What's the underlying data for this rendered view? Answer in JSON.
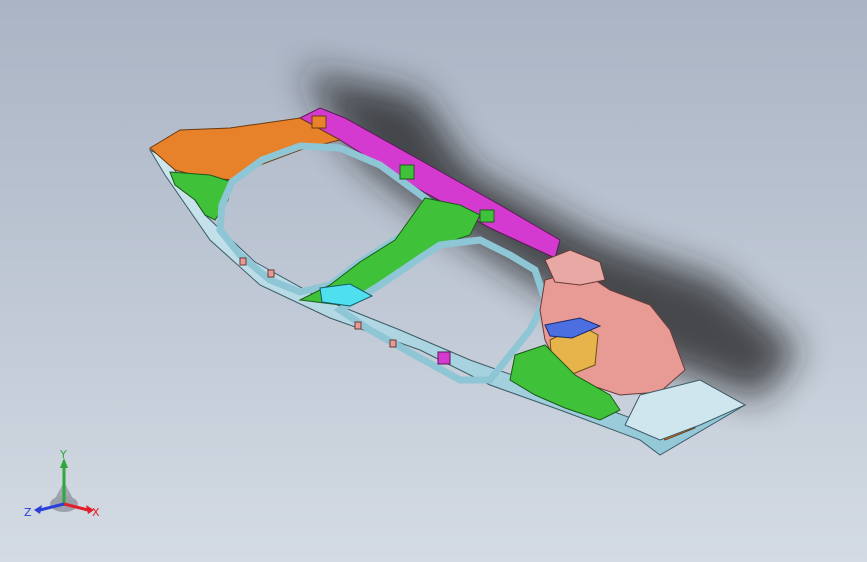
{
  "viewport": {
    "background_top": "#aab4c4",
    "background_bottom": "#d4dbe4"
  },
  "model": {
    "colors": {
      "orange": "#e8822a",
      "magenta": "#d43ad0",
      "green": "#3fc23a",
      "teal": "#9fd7e6",
      "pink": "#e89a95",
      "yellow": "#e6b44a",
      "blue": "#4b6ee0",
      "cyan": "#4fe0f0",
      "shadow": "#1c1c1c"
    }
  },
  "triad": {
    "y_label": "Y",
    "x_label": "X",
    "z_label": "Z",
    "y_color": "#2ea83a",
    "x_color": "#e0202a",
    "z_color": "#2a40d8"
  }
}
